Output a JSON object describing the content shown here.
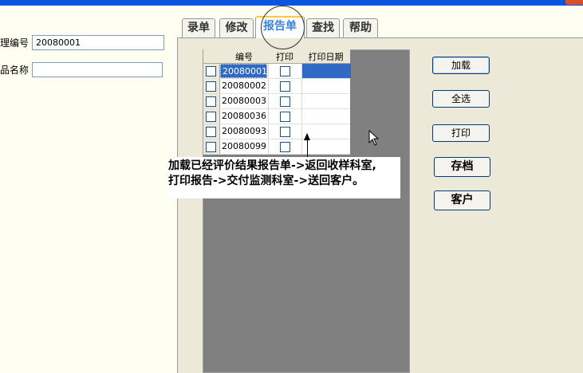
{
  "form": {
    "id_label": "理编号",
    "id_value": "20080001",
    "name_label": "品名称",
    "name_value": ""
  },
  "tabs": [
    "录单",
    "修改",
    "报告单",
    "查找",
    "帮助"
  ],
  "table": {
    "headers": [
      "编号",
      "打印",
      "打印日期"
    ],
    "rows": [
      {
        "code": "20080001",
        "selected": true
      },
      {
        "code": "20080002"
      },
      {
        "code": "20080003"
      },
      {
        "code": "20080036"
      },
      {
        "code": "20080093"
      },
      {
        "code": "20080099"
      }
    ]
  },
  "buttons": {
    "load": "加载",
    "select_all": "全选",
    "print": "打印",
    "archive": "存档",
    "customer": "客户"
  },
  "callout": {
    "line1": "加载已经评价结果报告单->返回收样科室,",
    "line2": "打印报告->交付监测科室->送回客户。"
  }
}
